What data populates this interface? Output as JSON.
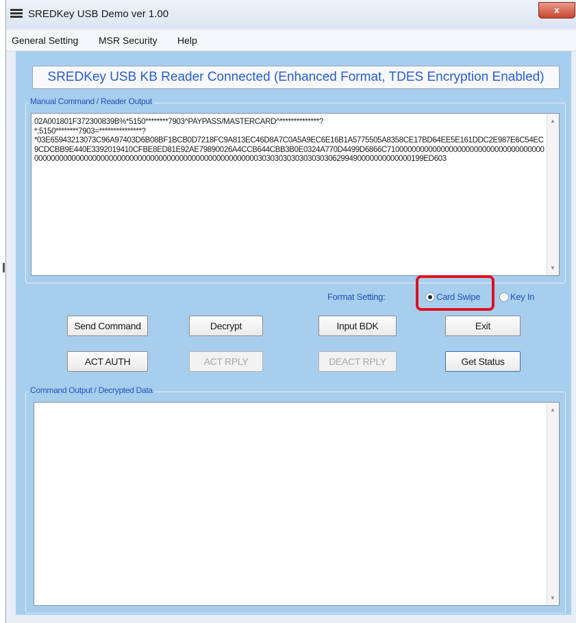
{
  "window": {
    "title": "SREDKey USB Demo ver 1.00",
    "close_label": "x"
  },
  "menu": [
    "General Setting",
    "MSR Security",
    "Help"
  ],
  "status_banner": "SREDKey USB KB Reader Connected  (Enhanced Format, TDES Encryption Enabled)",
  "reader_output": {
    "group_label": "Manual Command / Reader Output",
    "text": "02A001801F372300839B%*5150********7903^PAYPASS/MASTERCARD^**************?\n*;5150********7903=***************?\n*03E65943213073C96A97403D6B08BF1BCB0D7218FC9A813EC46D8A7C0A5A9EC6E16B1A5775505A8358CE17BD64EE5E161DDC2E987E6C54EC9CDCBB9E440E3392019410CFBE8ED81E92AE79890026A4CCB644CBB3B0E0324A770D4499D6866C710000000000000000000000000000000000000000000000000000000000000000000000000000000000000000003030303030303030306299490000000000000199ED603"
  },
  "format_setting": {
    "label": "Format Setting:",
    "options": [
      "Card Swipe",
      "Key In"
    ],
    "selected": "Card Swipe"
  },
  "buttons": {
    "send_command": "Send Command",
    "decrypt": "Decrypt",
    "input_bdk": "Input BDK",
    "exit": "Exit",
    "act_auth": "ACT AUTH",
    "act_rply": "ACT RPLY",
    "deact_rply": "DEACT RPLY",
    "get_status": "Get Status"
  },
  "decrypted_output": {
    "group_label": "Command Output / Decrypted Data",
    "text": ""
  },
  "colors": {
    "client_background": "#a8ceee",
    "label_blue": "#2350b8",
    "highlight_red": "#e0101e"
  }
}
